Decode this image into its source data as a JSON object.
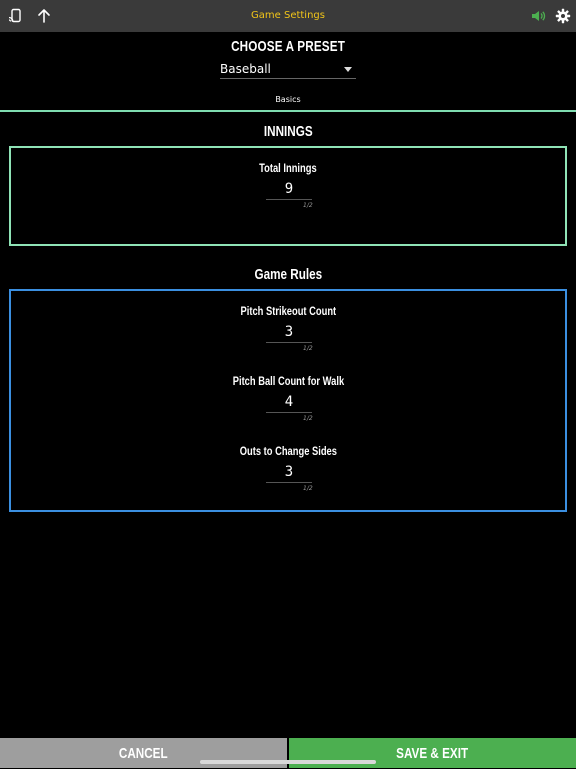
{
  "header": {
    "title": "Game Settings",
    "icons": [
      "cast-icon",
      "up-arrow-icon",
      "volume-icon",
      "gear-icon"
    ],
    "title_color": "#f0c419",
    "volume_color": "#4caf50"
  },
  "preset": {
    "heading": "CHOOSE A PRESET",
    "selected": "Baseball"
  },
  "tabs": [
    {
      "label": "Basics"
    }
  ],
  "sections": {
    "innings": {
      "title": "INNINGS",
      "fields": [
        {
          "label": "Total Innings",
          "value": "9",
          "counter": "1/2"
        }
      ]
    },
    "game_rules": {
      "title": "Game Rules",
      "fields": [
        {
          "label": "Pitch Strikeout Count",
          "value": "3",
          "counter": "1/2"
        },
        {
          "label": "Pitch Ball Count for Walk",
          "value": "4",
          "counter": "1/2"
        },
        {
          "label": "Outs to Change Sides",
          "value": "3",
          "counter": "1/2"
        }
      ]
    }
  },
  "footer": {
    "cancel_label": "CANCEL",
    "save_label": "SAVE & EXIT"
  },
  "colors": {
    "innings_border": "#8fe3b6",
    "rules_border": "#3b8fe0",
    "cancel_bg": "#9e9e9e",
    "save_bg": "#4caf50"
  }
}
